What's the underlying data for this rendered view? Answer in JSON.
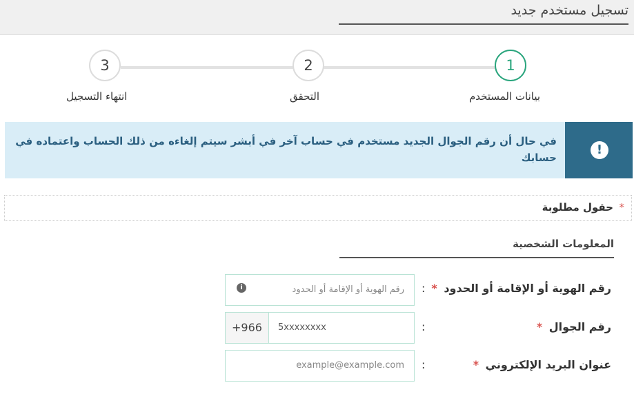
{
  "page": {
    "title": "تسجيل مستخدم جديد"
  },
  "steps": [
    {
      "number": "1",
      "label": "بيانات المستخدم",
      "state": "active"
    },
    {
      "number": "2",
      "label": "التحقق",
      "state": "inactive"
    },
    {
      "number": "3",
      "label": "انتهاء التسجيل",
      "state": "inactive"
    }
  ],
  "alert": {
    "icon": "exclamation-icon",
    "text": "في حال أن رقم الجوال الجديد مستخدم في حساب آخر في أبشر سيتم إلغاءه من ذلك الحساب واعتماده في حسابك"
  },
  "required_note": {
    "star": "*",
    "text": "حقول مطلوبة"
  },
  "section": {
    "title": "المعلومات الشخصية"
  },
  "form": {
    "id_field": {
      "label": "رقم الهوية أو الإقامة أو الحدود",
      "star": "*",
      "colon": ":",
      "placeholder": "رقم الهوية أو الإقامة أو الحدود",
      "icon": "info-icon"
    },
    "mobile_field": {
      "label": "رقم الجوال",
      "star": "*",
      "colon": ":",
      "prefix": "+966",
      "placeholder": "5xxxxxxxx"
    },
    "email_field": {
      "label": "عنوان البريد الإلكتروني",
      "star": "*",
      "colon": ":",
      "placeholder": "example@example.com"
    }
  },
  "colors": {
    "active_step": "#2aa57d",
    "alert_bg": "#d9edf7",
    "alert_icon_bg": "#2e6b8a",
    "required_star": "#d9534f",
    "field_border": "#b9e3d5"
  }
}
